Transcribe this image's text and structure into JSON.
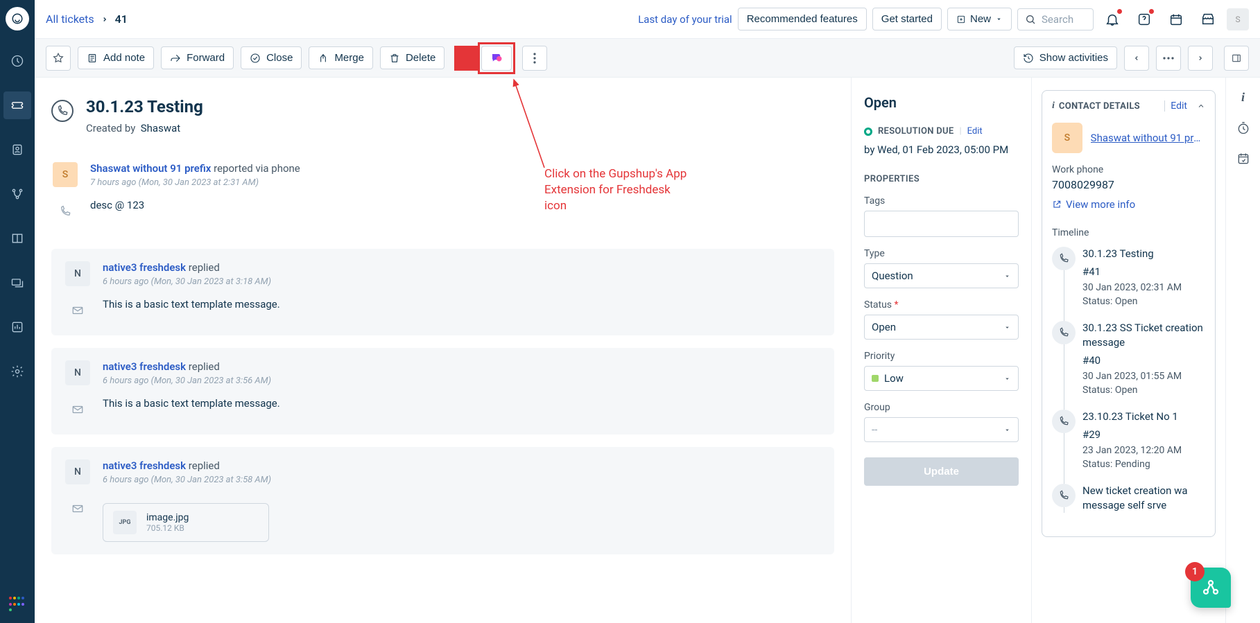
{
  "topbar": {
    "breadcrumb_root": "All tickets",
    "ticket_id": "41",
    "trial_text": "Last day of your trial",
    "recommended_label": "Recommended features",
    "get_started_label": "Get started",
    "new_label": "New",
    "search_placeholder": "Search",
    "avatar_initial": "S"
  },
  "actions": {
    "add_note": "Add note",
    "forward": "Forward",
    "close": "Close",
    "merge": "Merge",
    "delete": "Delete",
    "show_activities": "Show activities"
  },
  "annotation": {
    "text": "Click on the Gupshup's App Extension for Freshdesk icon"
  },
  "ticket": {
    "title": "30.1.23 Testing",
    "created_by_label": "Created by",
    "created_by_name": "Shaswat"
  },
  "messages": [
    {
      "avatar_initial": "S",
      "avatar_kind": "requester",
      "author": "Shaswat without 91 prefix",
      "via": "reported via phone",
      "time": "7 hours ago (Mon, 30 Jan 2023 at 2:31 AM)",
      "channel": "phone",
      "body": "desc @ 123",
      "reply": false
    },
    {
      "avatar_initial": "N",
      "avatar_kind": "agent",
      "author": "native3 freshdesk",
      "via": "replied",
      "time": "6 hours ago (Mon, 30 Jan 2023 at 3:18 AM)",
      "channel": "email",
      "body": "This is a basic text template message.",
      "reply": true
    },
    {
      "avatar_initial": "N",
      "avatar_kind": "agent",
      "author": "native3 freshdesk",
      "via": "replied",
      "time": "6 hours ago (Mon, 30 Jan 2023 at 3:56 AM)",
      "channel": "email",
      "body": "This is a basic text template message.",
      "reply": true
    },
    {
      "avatar_initial": "N",
      "avatar_kind": "agent",
      "author": "native3 freshdesk",
      "via": "replied",
      "time": "6 hours ago (Mon, 30 Jan 2023 at 3:58 AM)",
      "channel": "email",
      "attachment": {
        "name": "image.jpg",
        "size": "705.12 KB",
        "ext": "JPG"
      },
      "reply": true
    }
  ],
  "status": {
    "heading": "Open",
    "resolution_due_label": "RESOLUTION DUE",
    "edit_label": "Edit",
    "due_date": "by Wed, 01 Feb 2023, 05:00 PM",
    "properties_label": "PROPERTIES",
    "fields": {
      "tags_label": "Tags",
      "type_label": "Type",
      "type_value": "Question",
      "status_label": "Status",
      "status_value": "Open",
      "priority_label": "Priority",
      "priority_value": "Low",
      "group_label": "Group",
      "group_value": "--"
    },
    "update_label": "Update"
  },
  "contact": {
    "header_label": "CONTACT DETAILS",
    "edit_label": "Edit",
    "avatar_initial": "S",
    "name": "Shaswat without 91 pre…",
    "work_phone_label": "Work phone",
    "work_phone_value": "7008029987",
    "more_info_label": "View more info",
    "timeline_label": "Timeline",
    "timeline": [
      {
        "title": "30.1.23 Testing",
        "id": "#41",
        "date": "30 Jan 2023, 02:31 AM",
        "status": "Status: Open"
      },
      {
        "title": "30.1.23 SS Ticket creation message",
        "id": "#40",
        "date": "30 Jan 2023, 01:55 AM",
        "status": "Status: Open"
      },
      {
        "title": "23.10.23 Ticket No 1",
        "id": "#29",
        "date": "23 Jan 2023, 12:20 AM",
        "status": "Status: Pending"
      },
      {
        "title": "New ticket creation wa message self srve",
        "id": "",
        "date": "",
        "status": ""
      }
    ]
  },
  "float_badge": "1"
}
